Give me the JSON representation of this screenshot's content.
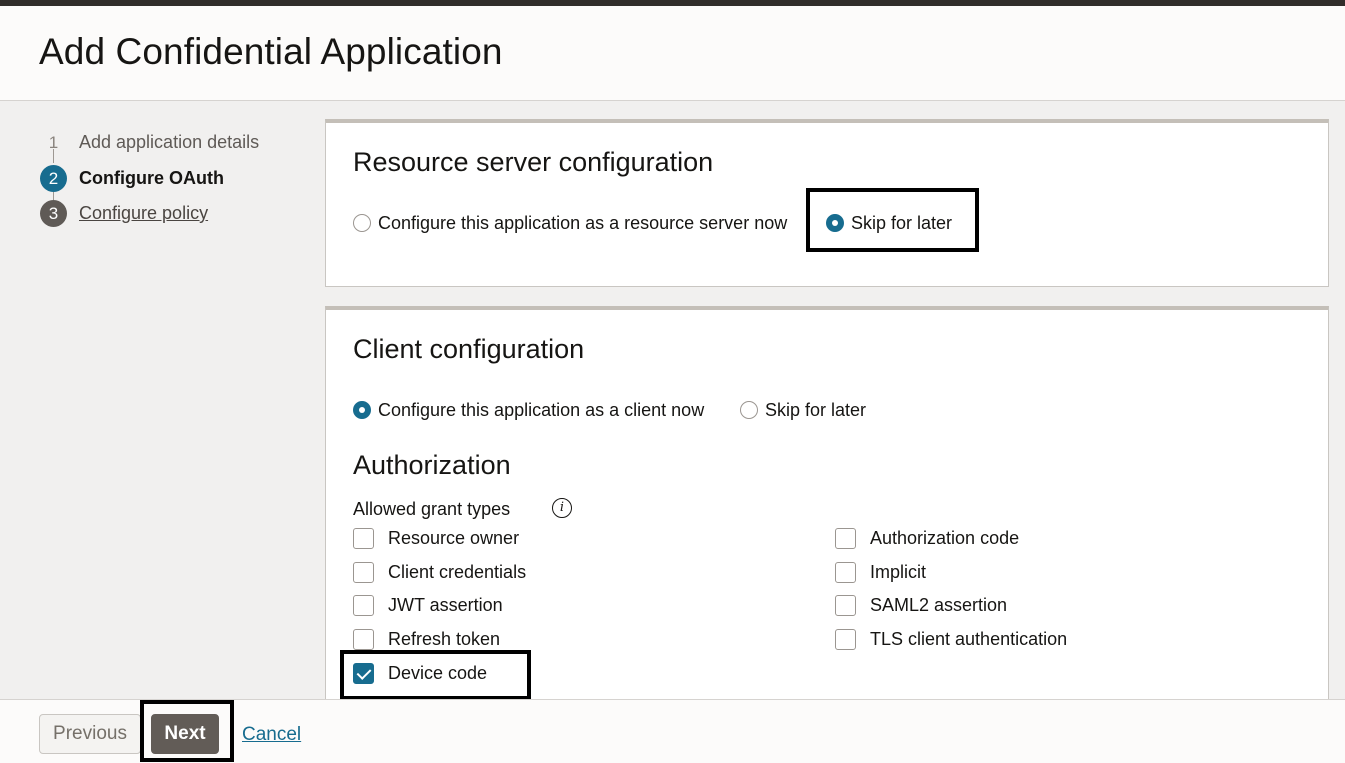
{
  "header": {
    "title": "Add Confidential Application"
  },
  "train": {
    "steps": [
      {
        "number": "1",
        "label": "Add application details",
        "state": "done"
      },
      {
        "number": "2",
        "label": "Configure OAuth",
        "state": "current"
      },
      {
        "number": "3",
        "label": "Configure policy",
        "state": "future"
      }
    ]
  },
  "resource_server": {
    "title": "Resource server configuration",
    "options": [
      {
        "label": "Configure this application as a resource server now",
        "selected": false
      },
      {
        "label": "Skip for later",
        "selected": true
      }
    ]
  },
  "client": {
    "title": "Client configuration",
    "options": [
      {
        "label": "Configure this application as a client now",
        "selected": true
      },
      {
        "label": "Skip for later",
        "selected": false
      }
    ],
    "authorization": {
      "heading": "Authorization",
      "allowed_grant_types_label": "Allowed grant types",
      "info_icon_glyph": "i",
      "grant_types": [
        {
          "label": "Resource owner",
          "checked": false
        },
        {
          "label": "Client credentials",
          "checked": false
        },
        {
          "label": "JWT assertion",
          "checked": false
        },
        {
          "label": "Refresh token",
          "checked": false
        },
        {
          "label": "Device code",
          "checked": true
        },
        {
          "label": "Authorization code",
          "checked": false
        },
        {
          "label": "Implicit",
          "checked": false
        },
        {
          "label": "SAML2 assertion",
          "checked": false
        },
        {
          "label": "TLS client authentication",
          "checked": false
        }
      ]
    }
  },
  "footer": {
    "previous_label": "Previous",
    "next_label": "Next",
    "cancel_label": "Cancel"
  },
  "colors": {
    "accent": "#176c8f",
    "next_button": "#625c57",
    "highlight_box": "#000000"
  },
  "icons": [
    "info-icon",
    "radio-selected-icon",
    "checkbox-checked-icon"
  ]
}
